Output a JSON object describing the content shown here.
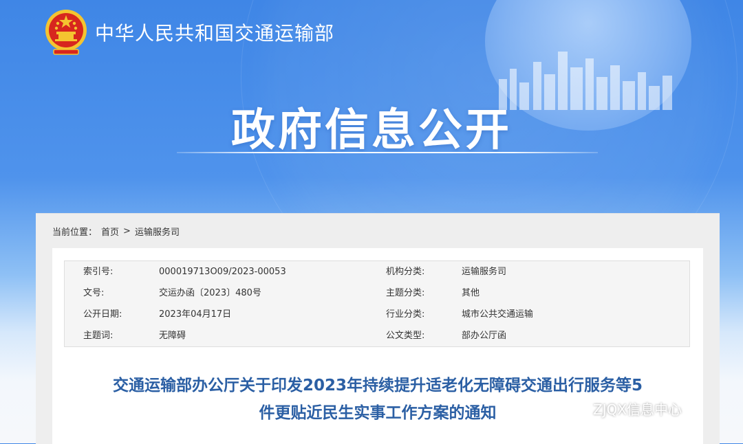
{
  "header": {
    "site_title": "中华人民共和国交通运输部"
  },
  "banner": {
    "title": "政府信息公开"
  },
  "breadcrumb": {
    "label": "当前位置：",
    "home": "首页",
    "separator": ">",
    "current": "运输服务司"
  },
  "meta": [
    {
      "label1": "索引号:",
      "value1": "000019713O09/2023-00053",
      "label2": "机构分类:",
      "value2": "运输服务司"
    },
    {
      "label1": "文号:",
      "value1": "交运办函〔2023〕480号",
      "label2": "主题分类:",
      "value2": "其他"
    },
    {
      "label1": "公开日期:",
      "value1": "2023年04月17日",
      "label2": "行业分类:",
      "value2": "城市公共交通运输"
    },
    {
      "label1": "主题词:",
      "value1": "无障碍",
      "label2": "公文类型:",
      "value2": "部办公厅函"
    }
  ],
  "document": {
    "title_line1": "交通运输部办公厅关于印发2023年持续提升适老化无障碍交通出行服务等5",
    "title_line2": "件更贴近民生实事工作方案的通知"
  },
  "watermark": {
    "text": "ZJQX信息中心",
    "icon": "wechat-icon"
  },
  "colors": {
    "banner_blue": "#4a8eea",
    "title_blue": "#2b5fa4",
    "emblem_red": "#d7261e",
    "emblem_gold": "#f4c430"
  }
}
